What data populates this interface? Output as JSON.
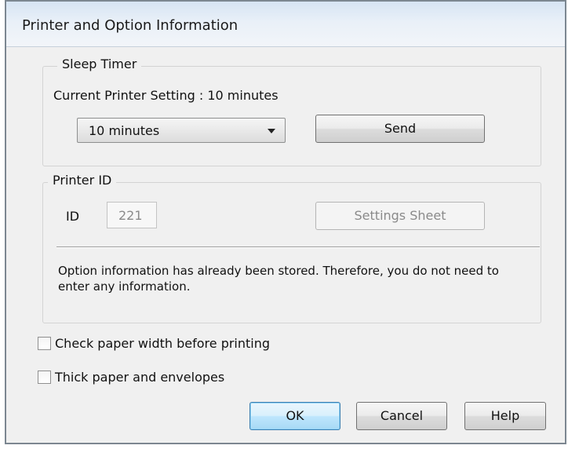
{
  "window": {
    "title": "Printer and Option Information"
  },
  "sleep_timer": {
    "group_title": "Sleep Timer",
    "current_setting": "Current Printer Setting : 10 minutes",
    "dropdown_value": "10 minutes",
    "send_label": "Send"
  },
  "printer_id": {
    "group_title": "Printer ID",
    "id_label": "ID",
    "id_value": "221",
    "settings_sheet_label": "Settings Sheet",
    "info_line1": "Option information has already been stored. Therefore, you do not need to",
    "info_line2": "enter any information."
  },
  "options": {
    "check_paper_width": {
      "label": "Check paper width before printing",
      "checked": false
    },
    "thick_paper": {
      "label": "Thick paper and envelopes",
      "checked": false
    }
  },
  "footer": {
    "ok_label": "OK",
    "cancel_label": "Cancel",
    "help_label": "Help"
  },
  "icons": {
    "dropdown_arrow": "chevron-down-icon"
  }
}
